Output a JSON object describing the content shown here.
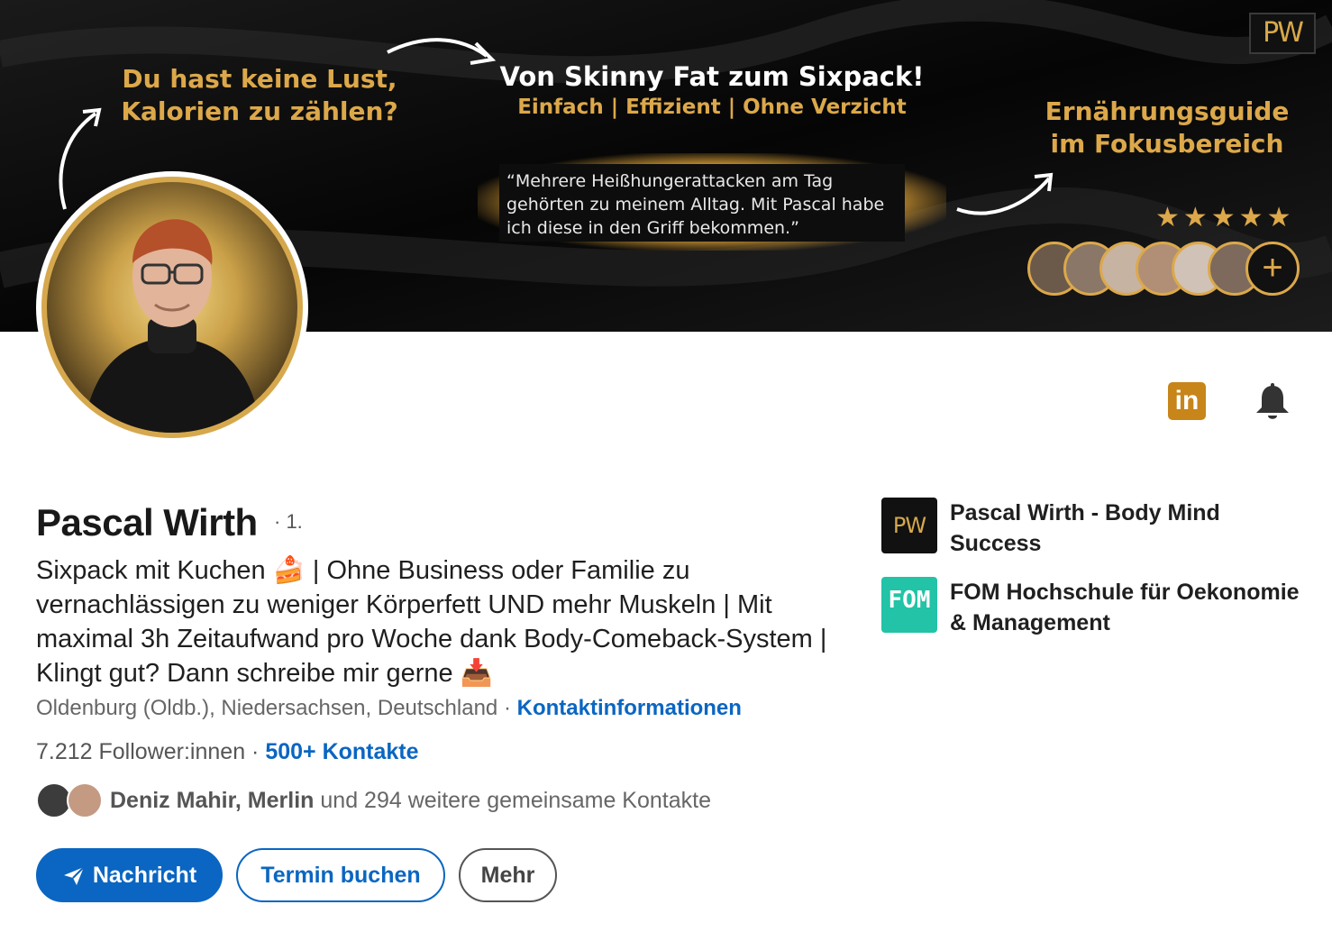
{
  "banner": {
    "logo_text": "PW",
    "left_text": "Du hast keine Lust, Kalorien zu zählen?",
    "title": "Von Skinny Fat zum Sixpack!",
    "subtitle": "Einfach | Effizient | Ohne Verzicht",
    "quote": "“Mehrere Heißhungerattacken am Tag gehörten zu meinem Alltag. Mit Pascal habe ich diese in den Griff bekommen.”",
    "right_text": "Ernährungsguide im Fokusbereich",
    "stars": "★★★★★",
    "plus": "+"
  },
  "profile": {
    "name": "Pascal Wirth",
    "degree": "· 1.",
    "headline": "Sixpack mit Kuchen 🍰 | Ohne Business oder Familie zu vernachlässigen zu weniger Körperfett UND mehr Muskeln | Mit maximal 3h Zeitaufwand pro Woche dank Body-Comeback-System | Klingt gut? Dann schreibe mir gerne 📥",
    "location": "Oldenburg (Oldb.), Niedersachsen, Deutschland",
    "location_separator": " · ",
    "contact_info_link": "Kontaktinformationen",
    "followers": "7.212 Follower:innen",
    "followers_separator": " · ",
    "connections_link": "500+ Kontakte",
    "mutual_names": "Deniz Mahir, Merlin",
    "mutual_rest": " und 294 weitere gemeinsame Kontakte"
  },
  "actions": {
    "message": "Nachricht",
    "book": "Termin buchen",
    "more": "Mehr"
  },
  "icons": {
    "linkedin": "in"
  },
  "companies": [
    {
      "logo": "PW",
      "name": "Pascal Wirth - Body Mind Success"
    },
    {
      "logo": "FOM",
      "name": "FOM Hochschule für Oekonomie & Management"
    }
  ],
  "colors": {
    "accent": "#0a66c2",
    "gold": "#dca84a",
    "linkedin_badge": "#c7851a"
  }
}
